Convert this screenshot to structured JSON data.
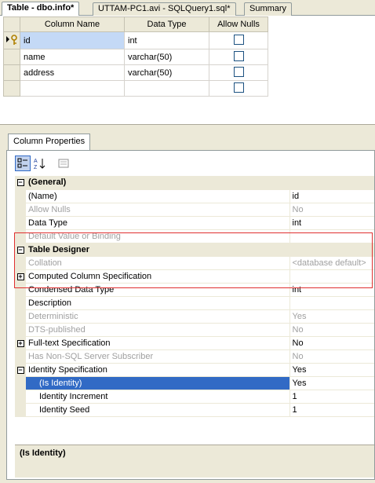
{
  "doc_tabs": [
    {
      "label": "Table - dbo.info*"
    },
    {
      "label": "UTTAM-PC1.avi - SQLQuery1.sql*"
    },
    {
      "label": "Summary"
    }
  ],
  "grid": {
    "headers": [
      "Column Name",
      "Data Type",
      "Allow Nulls"
    ],
    "rows": [
      {
        "name": "id",
        "type": "int"
      },
      {
        "name": "name",
        "type": "varchar(50)"
      },
      {
        "name": "address",
        "type": "varchar(50)"
      },
      {
        "name": "",
        "type": ""
      }
    ]
  },
  "properties_tab": "Column Properties",
  "properties": [
    {
      "kind": "cat",
      "name": "(General)"
    },
    {
      "name": "(Name)",
      "value": "id"
    },
    {
      "name": "Allow Nulls",
      "value": "No",
      "disabled": true
    },
    {
      "name": "Data Type",
      "value": "int"
    },
    {
      "name": "Default Value or Binding",
      "value": "",
      "disabled": true
    },
    {
      "kind": "cat",
      "name": "Table Designer"
    },
    {
      "name": "Collation",
      "value": "<database default>",
      "disabled": true
    },
    {
      "name": "Computed Column Specification",
      "value": "",
      "expandable": true
    },
    {
      "name": "Condensed Data Type",
      "value": "int"
    },
    {
      "name": "Description",
      "value": ""
    },
    {
      "name": "Deterministic",
      "value": "Yes",
      "disabled": true
    },
    {
      "name": "DTS-published",
      "value": "No",
      "disabled": true
    },
    {
      "name": "Full-text Specification",
      "value": "No",
      "expandable": true
    },
    {
      "name": "Has Non-SQL Server Subscriber",
      "value": "No",
      "disabled": true
    },
    {
      "name": "Identity Specification",
      "value": "Yes",
      "expanded": true
    },
    {
      "name": "(Is Identity)",
      "value": "Yes",
      "child": true,
      "selected": true
    },
    {
      "name": "Identity Increment",
      "value": "1",
      "child": true
    },
    {
      "name": "Identity Seed",
      "value": "1",
      "child": true
    }
  ],
  "description_title": "(Is Identity)"
}
